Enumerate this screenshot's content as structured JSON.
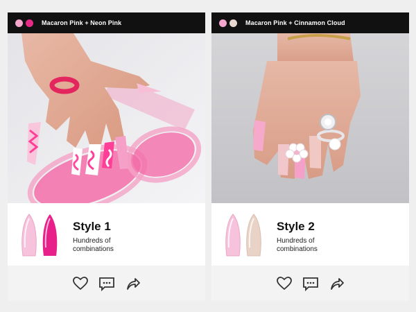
{
  "cards": [
    {
      "header": {
        "title": "Macaron Pink + Neon Pink",
        "dot_colors": [
          "#f6a6cd",
          "#e82a87"
        ]
      },
      "style_title": "Style 1",
      "description": "Hundreds of combinations",
      "swatch_colors": [
        "#f7c2dc",
        "#e8218a"
      ],
      "actions": [
        "heart-icon",
        "comment-icon",
        "share-icon"
      ]
    },
    {
      "header": {
        "title": "Macaron Pink + Cinnamon Cloud",
        "dot_colors": [
          "#f6a6cd",
          "#e9d8cf"
        ]
      },
      "style_title": "Style 2",
      "description": "Hundreds of combinations",
      "swatch_colors": [
        "#f7c2dc",
        "#e9d3c6"
      ],
      "actions": [
        "heart-icon",
        "comment-icon",
        "share-icon"
      ]
    }
  ]
}
